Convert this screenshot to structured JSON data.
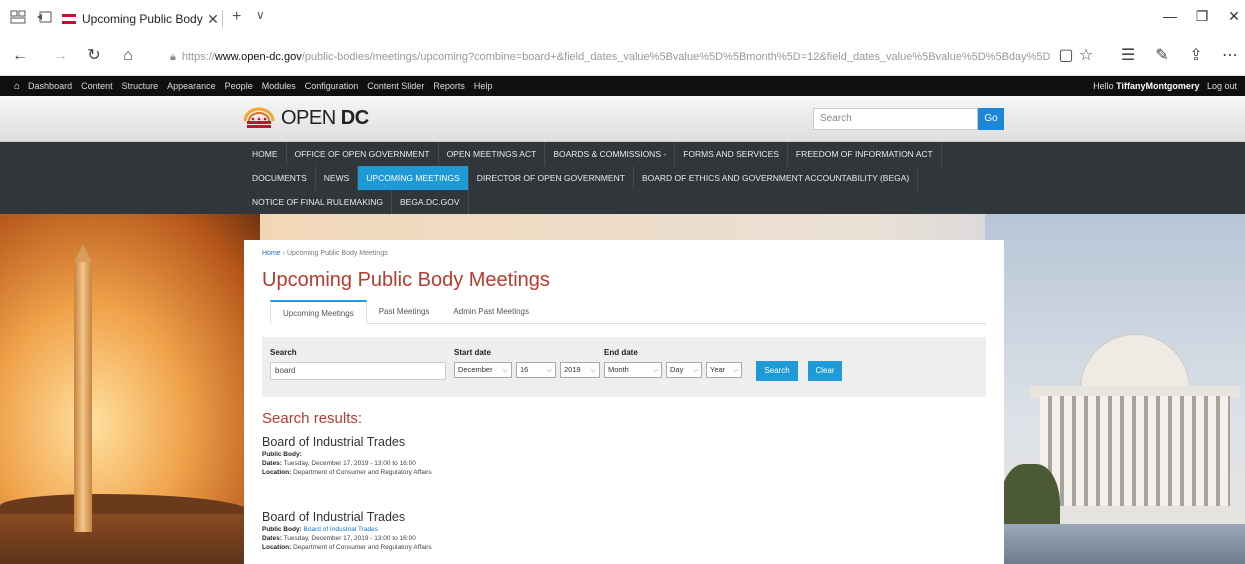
{
  "browser": {
    "tab_title": "Upcoming Public Body",
    "tab_close": "✕",
    "tab_new": "+",
    "tab_list": "∨",
    "url_protocol": "https://",
    "url_domain": "www.open-dc.gov",
    "url_path": "/public-bodies/meetings/upcoming?combine=board+&field_dates_value%5Bvalue%5D%5Bmonth%5D=12&field_dates_value%5Bvalue%5D%5Bday%5D=1"
  },
  "admin_toolbar": {
    "items": [
      "Dashboard",
      "Content",
      "Structure",
      "Appearance",
      "People",
      "Modules",
      "Configuration",
      "Content Slider",
      "Reports",
      "Help"
    ],
    "greeting_prefix": "Hello",
    "user": "TiffanyMontgomery",
    "logout": "Log out"
  },
  "site": {
    "logo_prefix": "OPEN",
    "logo_suffix": "DC",
    "search_placeholder": "Search",
    "search_go": "Go"
  },
  "main_nav": {
    "row1": [
      "HOME",
      "OFFICE OF OPEN GOVERNMENT",
      "OPEN MEETINGS ACT",
      "BOARDS & COMMISSIONS -",
      "FORMS AND SERVICES",
      "FREEDOM OF INFORMATION ACT"
    ],
    "row2": [
      "DOCUMENTS",
      "NEWS",
      "UPCOMING MEETINGS",
      "DIRECTOR OF OPEN GOVERNMENT",
      "BOARD OF ETHICS AND GOVERNMENT ACCOUNTABILITY (BEGA)"
    ],
    "row3": [
      "NOTICE OF FINAL RULEMAKING",
      "BEGA.DC.GOV"
    ],
    "active": "UPCOMING MEETINGS"
  },
  "page": {
    "breadcrumb_home": "Home",
    "breadcrumb_sep": "›",
    "breadcrumb_current": "Upcoming Public Body Meetings",
    "title": "Upcoming Public Body Meetings",
    "tabs": [
      "Upcoming Meetings",
      "Past Meetings",
      "Admin Past Meetings"
    ]
  },
  "filter": {
    "search_label": "Search",
    "search_value": "board",
    "start_label": "Start date",
    "start_month": "December",
    "start_day": "16",
    "start_year": "2019",
    "end_label": "End date",
    "end_month": "Month",
    "end_day": "Day",
    "end_year": "Year",
    "search_button": "Search",
    "clear_button": "Clear"
  },
  "results": {
    "title": "Search results:",
    "items": [
      {
        "title": "Board of Industrial Trades",
        "public_body_label": "Public Body:",
        "public_body": "",
        "dates_label": "Dates:",
        "dates": "Tuesday, December 17, 2019 - 13:00 to 16:00",
        "location_label": "Location:",
        "location": "Department of Consumer and Regulatory Affairs"
      },
      {
        "title": "Board of Industrial Trades",
        "public_body_label": "Public Body:",
        "public_body": "Board of Industrial Trades",
        "dates_label": "Dates:",
        "dates": "Tuesday, December 17, 2019 - 13:00 to 16:00",
        "location_label": "Location:",
        "location": "Department of Consumer and Regulatory Affairs"
      }
    ]
  },
  "colors": {
    "accent_blue": "#1e9ad6",
    "title_red": "#b83b2e",
    "nav_dark": "#31363b"
  }
}
